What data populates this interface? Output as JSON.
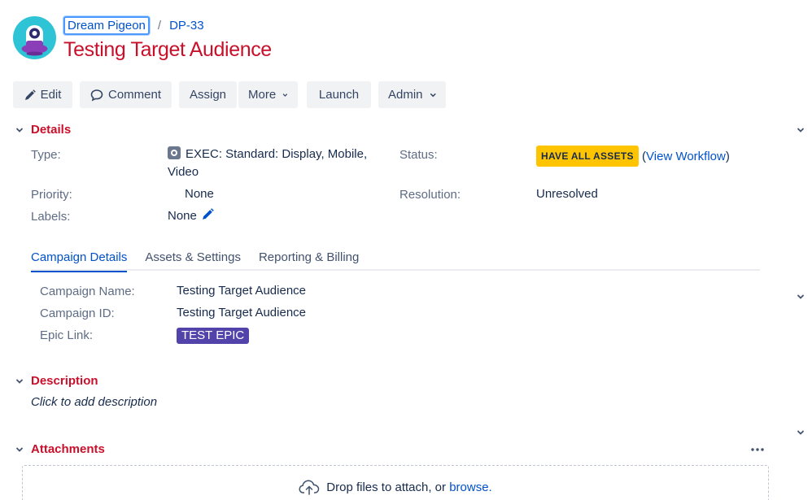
{
  "breadcrumb": {
    "project": "Dream Pigeon",
    "separator": "/",
    "issue_key": "DP-33"
  },
  "issue": {
    "title": "Testing Target Audience"
  },
  "toolbar": {
    "edit": "Edit",
    "comment": "Comment",
    "assign": "Assign",
    "more": "More",
    "launch": "Launch",
    "admin": "Admin"
  },
  "details": {
    "title": "Details",
    "type_label": "Type:",
    "type_value_line1": "EXEC: Standard: Display, Mobile,",
    "type_value_line2": "Video",
    "status_label": "Status:",
    "status_value": "HAVE ALL ASSETS",
    "status_paren_open": "(",
    "view_workflow": "View Workflow",
    "status_paren_close": ")",
    "priority_label": "Priority:",
    "priority_value": "None",
    "resolution_label": "Resolution:",
    "resolution_value": "Unresolved",
    "labels_label": "Labels:",
    "labels_value": "None"
  },
  "tabs": [
    {
      "label": "Campaign Details",
      "active": true
    },
    {
      "label": "Assets & Settings",
      "active": false
    },
    {
      "label": "Reporting & Billing",
      "active": false
    }
  ],
  "campaign": {
    "name_label": "Campaign Name:",
    "name_value": "Testing Target Audience",
    "id_label": "Campaign ID:",
    "id_value": "Testing Target Audience",
    "epic_label": "Epic Link:",
    "epic_value": "TEST EPIC"
  },
  "description": {
    "title": "Description",
    "placeholder": "Click to add description"
  },
  "attachments": {
    "title": "Attachments",
    "drop_text": "Drop files to attach, or ",
    "browse": "browse",
    "period": "."
  },
  "colors": {
    "title_red": "#c9102b",
    "link_blue": "#0052cc",
    "status_yellow": "#ffc400",
    "epic_purple": "#5243aa",
    "button_bg": "#f1f2f4"
  }
}
